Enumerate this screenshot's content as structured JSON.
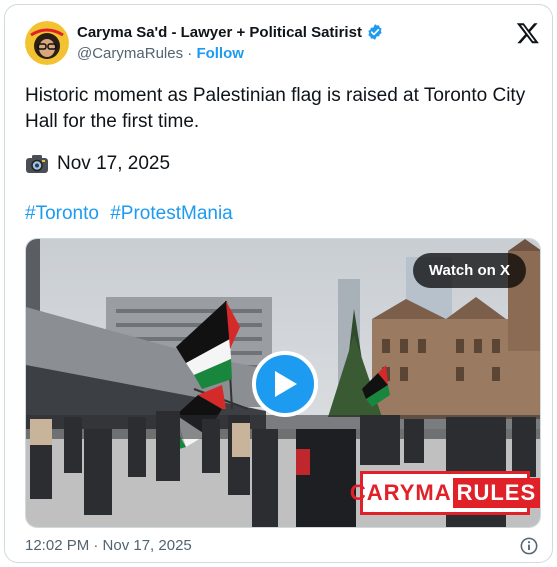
{
  "author": {
    "name": "Caryma Sa'd - Lawyer + Political Satirist",
    "handle": "@CarymaRules",
    "separator": "·",
    "follow_label": "Follow",
    "verified": true
  },
  "post": {
    "text": "Historic moment as Palestinian flag is raised at Toronto City Hall for the first time.",
    "date_emoji": "camera-icon",
    "date_text": "Nov 17, 2025",
    "hashtags": [
      "#Toronto",
      "#ProtestMania"
    ]
  },
  "media": {
    "watch_label": "Watch on X",
    "watermark_part1": "CARYMA",
    "watermark_part2": "RULES"
  },
  "footer": {
    "timestamp": "12:02 PM · Nov 17, 2025"
  },
  "colors": {
    "accent": "#1d9bf0",
    "watermark_red": "#e02128"
  }
}
